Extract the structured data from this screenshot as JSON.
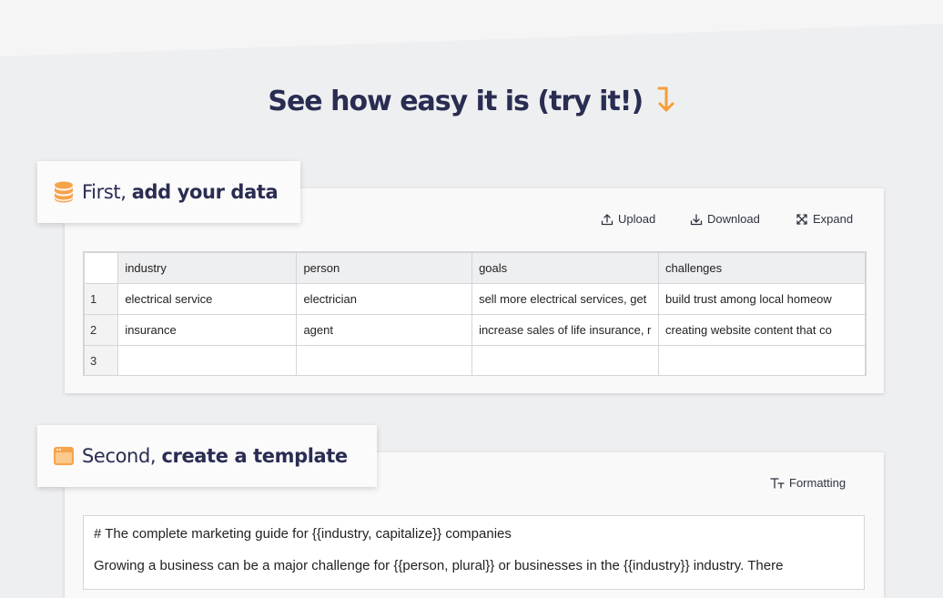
{
  "hero": {
    "title": "See how easy it is (try it!)",
    "arrow_icon": "orange-down-arrow-icon",
    "accent_color": "#f79d3a"
  },
  "data_section": {
    "tag_prefix": "First, ",
    "tag_bold": "add your data",
    "tag_icon": "database-icon",
    "toolbar": {
      "upload": "Upload",
      "download": "Download",
      "expand": "Expand"
    },
    "table": {
      "columns": [
        "industry",
        "person",
        "goals",
        "challenges"
      ],
      "rows": [
        {
          "num": "1",
          "cells": [
            "electrical service",
            "electrician",
            "sell more electrical services, get",
            "build trust among local homeow"
          ]
        },
        {
          "num": "2",
          "cells": [
            "insurance",
            "agent",
            "increase sales of life insurance, r",
            "creating website content that co"
          ]
        },
        {
          "num": "3",
          "cells": [
            "",
            "",
            "",
            ""
          ]
        }
      ]
    }
  },
  "template_section": {
    "tag_prefix": "Second, ",
    "tag_bold": "create a template",
    "tag_icon": "browser-window-icon",
    "toolbar": {
      "formatting": "Formatting"
    },
    "editor": {
      "line1": "# The complete marketing guide for {{industry, capitalize}} companies",
      "line2": "Growing a business can be a major challenge for {{person, plural}} or businesses in the {{industry}} industry. There"
    }
  }
}
